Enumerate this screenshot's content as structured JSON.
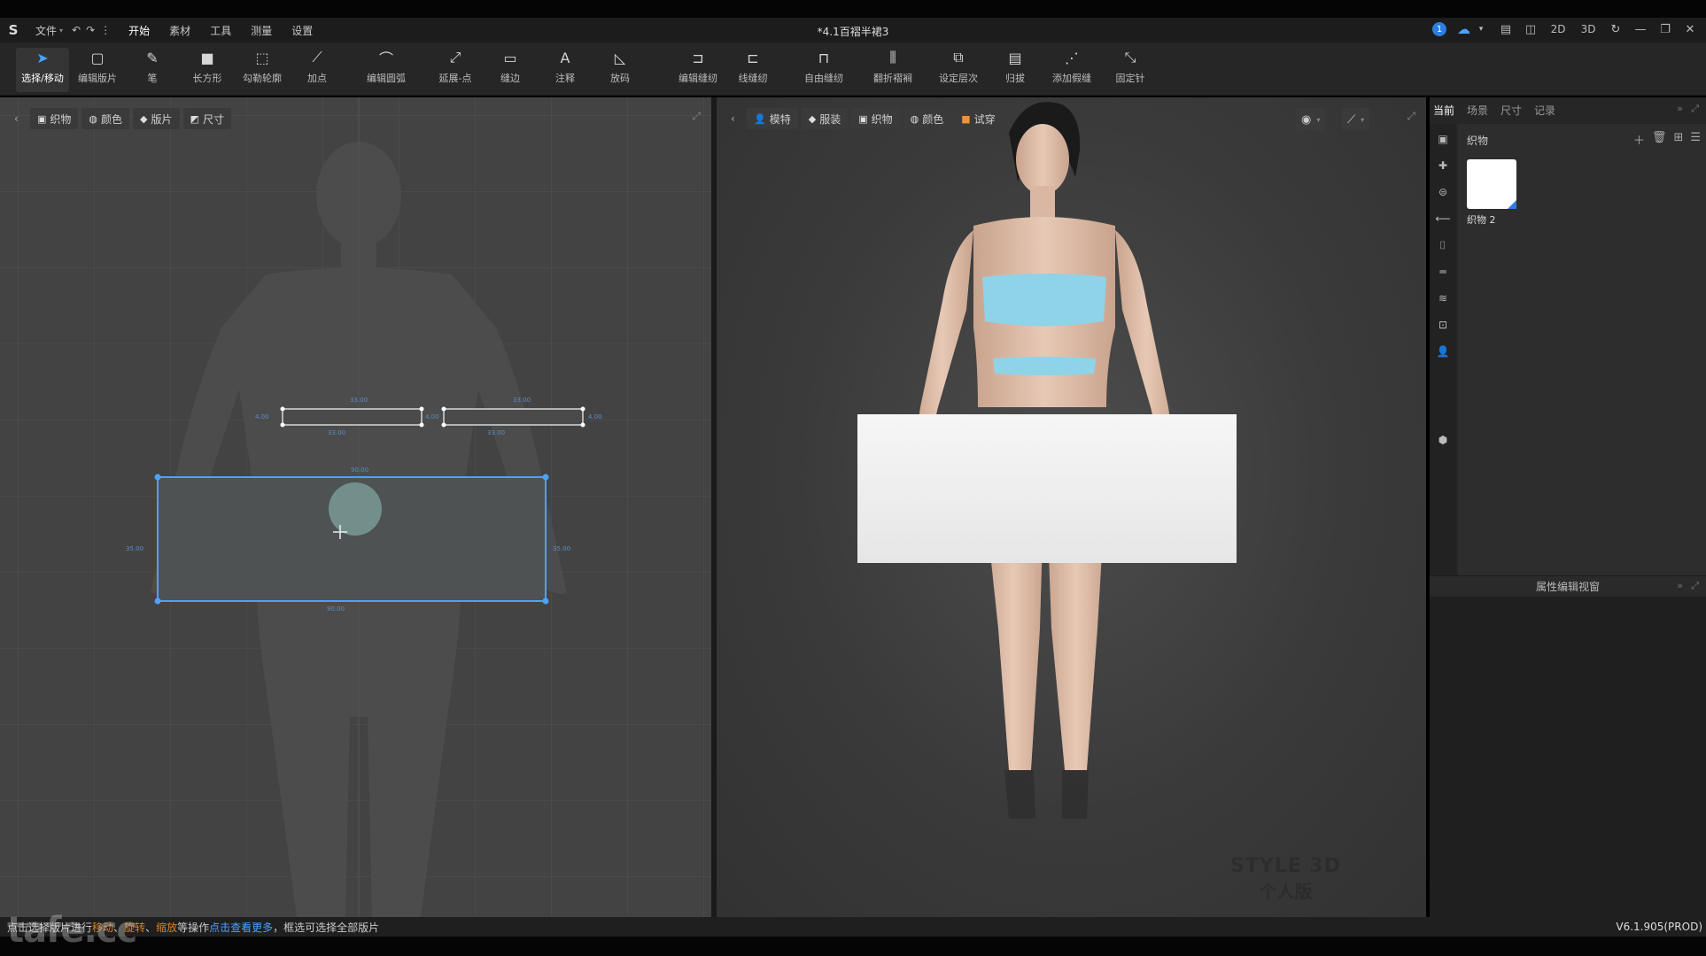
{
  "app": {
    "title": "*4.1百褶半裙3",
    "logo": "S",
    "version": "V6.1.905(PROD)",
    "notification_count": "1",
    "view_modes": [
      "2D",
      "3D"
    ]
  },
  "menu": [
    "文件",
    "开始",
    "素材",
    "工具",
    "测量",
    "设置"
  ],
  "toolbar": {
    "tools": [
      {
        "label": "选择/移动",
        "icon": "cursor-icon",
        "glyph": "➤",
        "active": true
      },
      {
        "label": "编辑版片",
        "icon": "edit-pattern-icon",
        "glyph": "▢"
      },
      {
        "label": "笔",
        "icon": "pen-icon",
        "glyph": "✎"
      },
      {
        "label": "长方形",
        "icon": "rectangle-icon",
        "glyph": "■"
      },
      {
        "label": "勾勒轮廓",
        "icon": "trace-outline-icon",
        "glyph": "⬚"
      },
      {
        "label": "加点",
        "icon": "add-point-icon",
        "glyph": "⟋"
      },
      {
        "label": "编辑圆弧",
        "icon": "edit-arc-icon",
        "glyph": "⌒"
      },
      {
        "label": "延展-点",
        "icon": "extend-point-icon",
        "glyph": "⤢"
      },
      {
        "label": "缝边",
        "icon": "seam-allowance-icon",
        "glyph": "▭"
      },
      {
        "label": "注释",
        "icon": "annotation-icon",
        "glyph": "A"
      },
      {
        "label": "放码",
        "icon": "grading-icon",
        "glyph": "◺"
      },
      {
        "label": "编辑缝纫",
        "icon": "edit-sewing-icon",
        "glyph": "⊐"
      },
      {
        "label": "线缝纫",
        "icon": "line-sewing-icon",
        "glyph": "⊏"
      },
      {
        "label": "自由缝纫",
        "icon": "free-sewing-icon",
        "glyph": "⊓"
      },
      {
        "label": "翻折褶裥",
        "icon": "fold-pleat-icon",
        "glyph": "⫼"
      },
      {
        "label": "设定层次",
        "icon": "set-layer-icon",
        "glyph": "⧉"
      },
      {
        "label": "归拔",
        "icon": "shrink-icon",
        "glyph": "▤"
      },
      {
        "label": "添加假缝",
        "icon": "add-tack-icon",
        "glyph": "⋰"
      },
      {
        "label": "固定针",
        "icon": "pin-icon",
        "glyph": "⤡"
      }
    ]
  },
  "panel2d": {
    "tabs": [
      "织物",
      "颜色",
      "版片",
      "尺寸"
    ],
    "measurements": {
      "band1_top": "33.00",
      "band1_bottom": "33.00",
      "band1_left": "4.00",
      "band2_top": "33.00",
      "band2_bottom": "33.00",
      "band2_right": "4.00",
      "mid": "4.00",
      "rect_top": "90.00",
      "rect_bottom": "90.00",
      "rect_left": "35.00",
      "rect_right": "35.00"
    }
  },
  "panel3d": {
    "tabs": [
      "模特",
      "服装",
      "织物",
      "颜色",
      "试穿"
    ],
    "watermark_line1": "STYLE 3D",
    "watermark_line2": "个人版"
  },
  "right_panel": {
    "tabs": [
      "当前",
      "场景",
      "尺寸",
      "记录"
    ],
    "section_title": "织物",
    "fabric_name": "织物 2",
    "fabric_color": "#ffffff",
    "property_header": "属性编辑视窗"
  },
  "status": {
    "part1": "点击选择版片进行",
    "hl1": "移动",
    "sep1": "、",
    "hl2": "旋转",
    "sep2": "、",
    "hl3": "缩放",
    "part2": "等操作 ",
    "link": "点击查看更多",
    "part3": "，框选可选择全部版片"
  },
  "corner_watermark": "tafe.cc",
  "colors": {
    "accent": "#4aa3ff",
    "selection": "#4aa3ff",
    "garment": "#8fd3e8",
    "highlight": "#d9822b"
  }
}
